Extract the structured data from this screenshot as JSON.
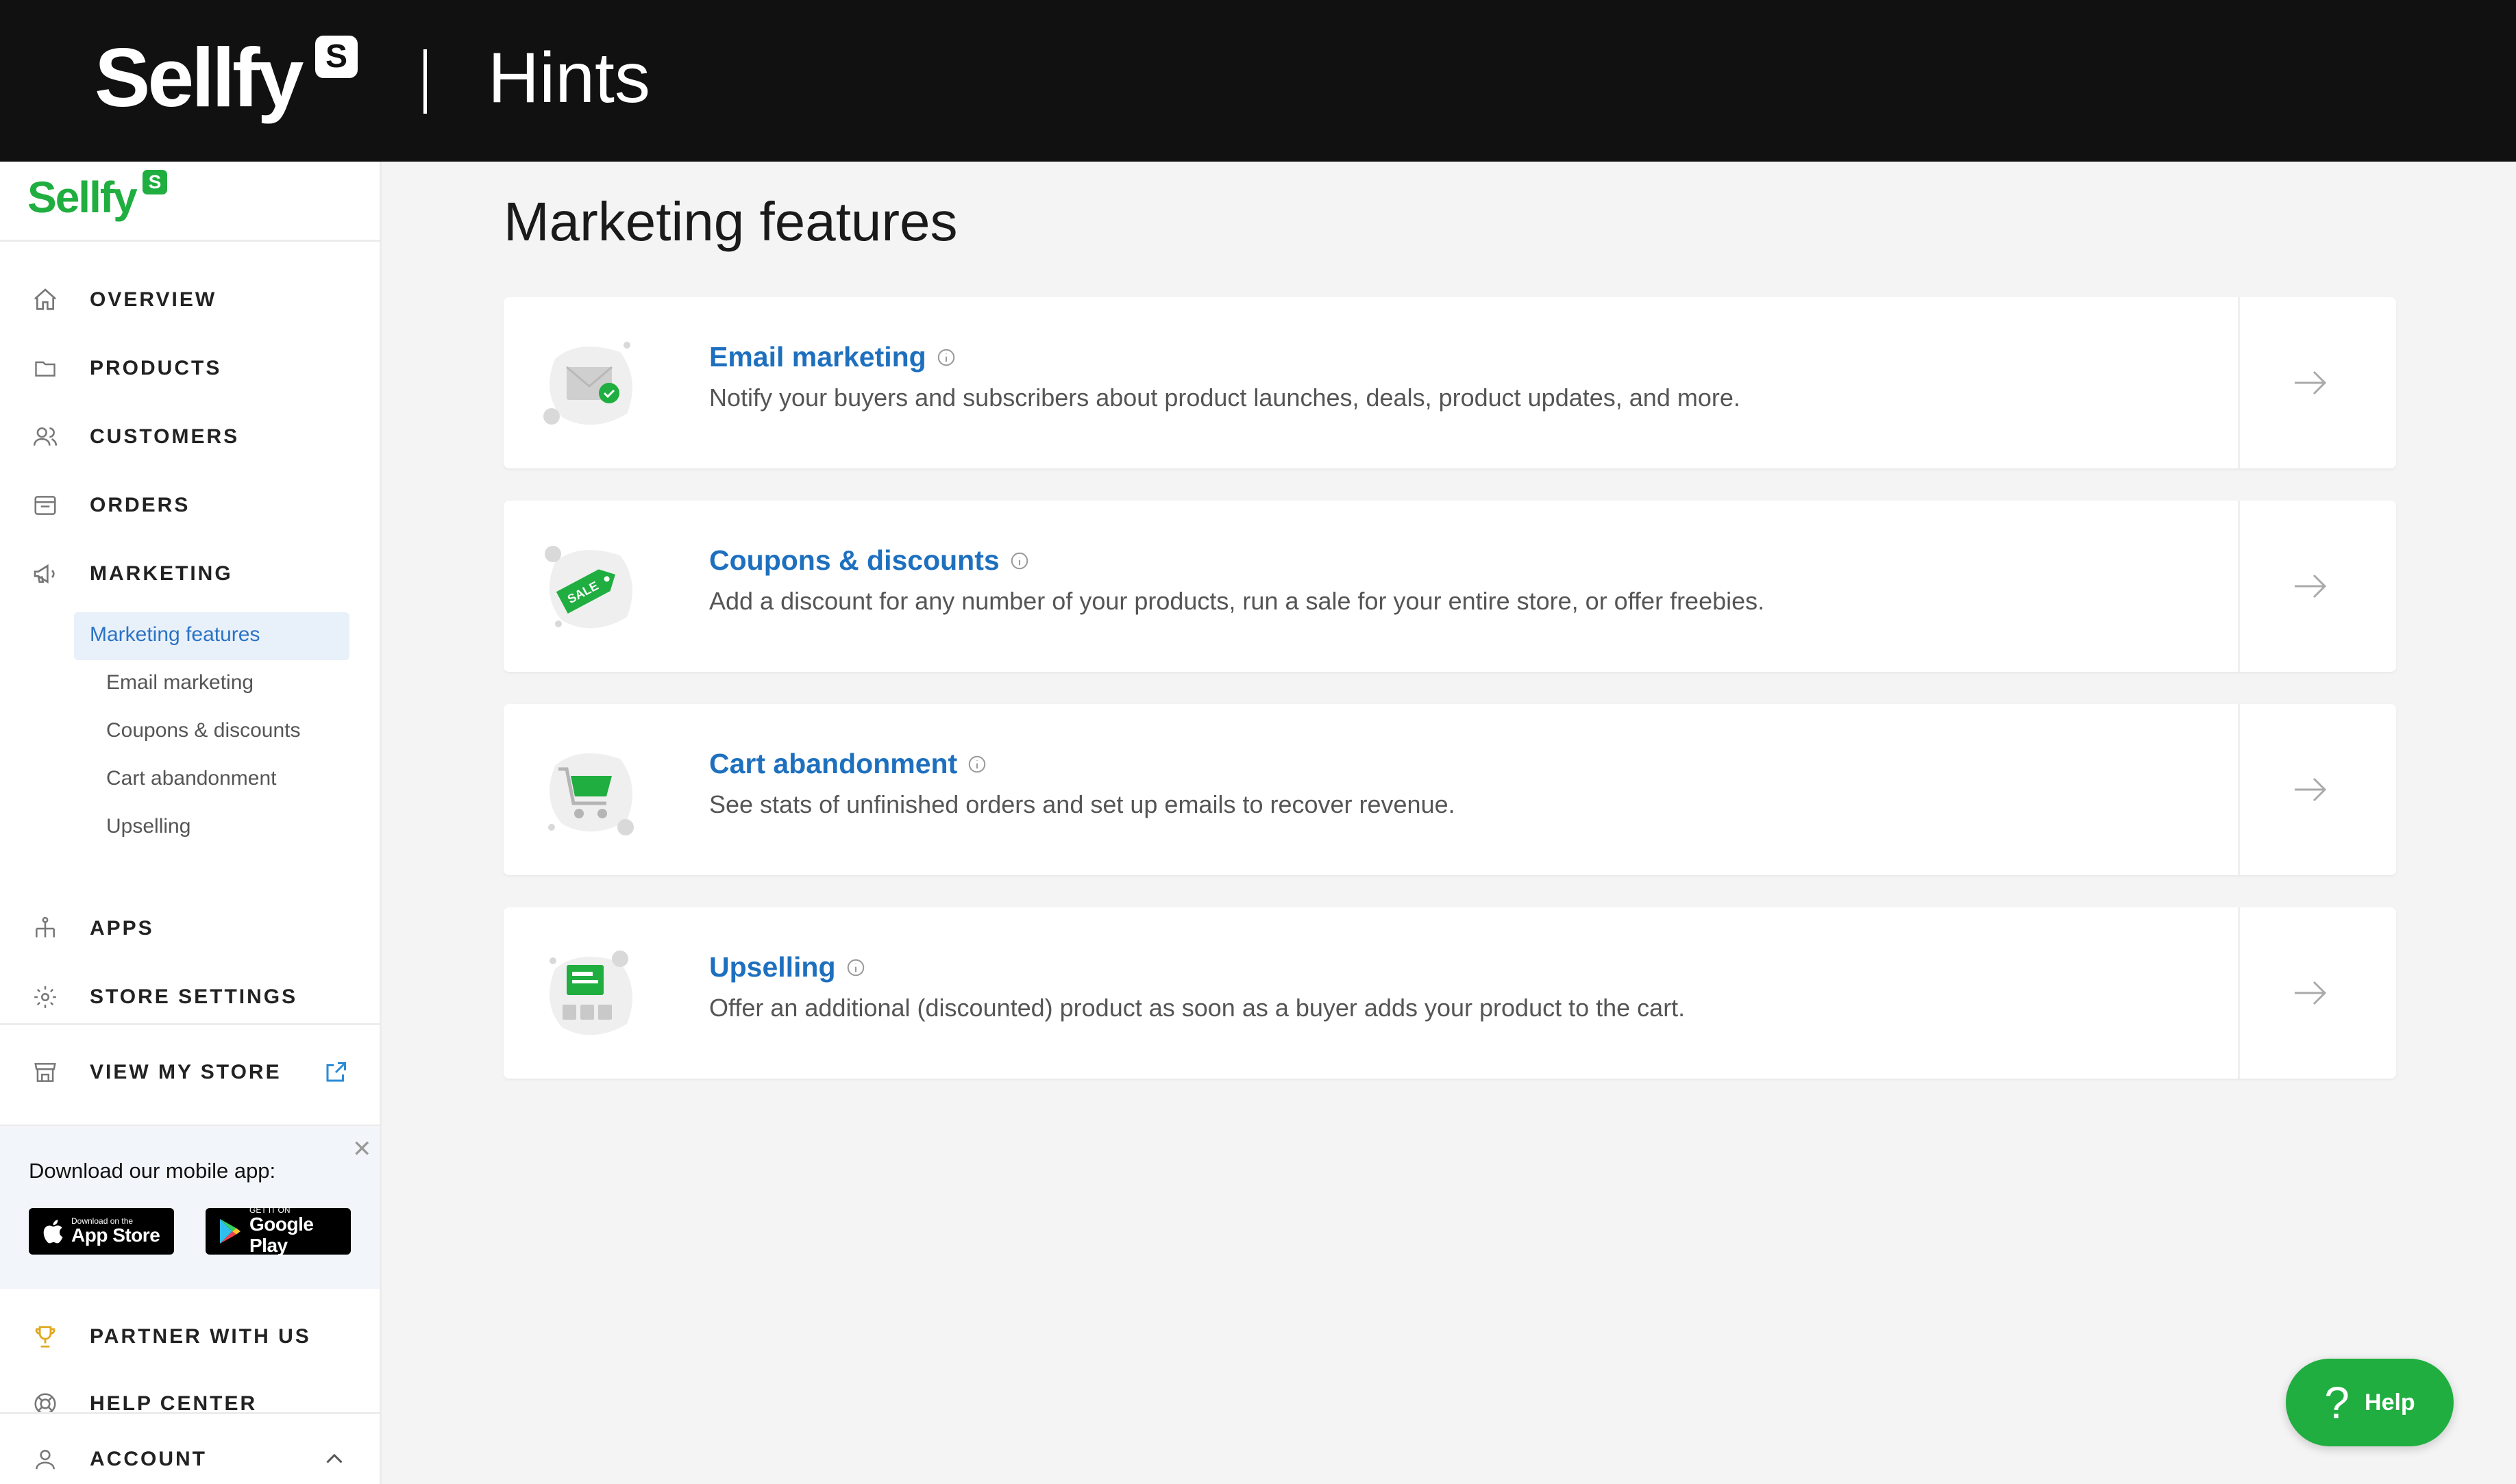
{
  "banner": {
    "brand": "Sellfy",
    "brand_badge": "S",
    "title": "Hints"
  },
  "sidebar": {
    "logo": "Sellfy",
    "logo_badge": "S",
    "nav": [
      {
        "label": "OVERVIEW",
        "icon": "home-icon"
      },
      {
        "label": "PRODUCTS",
        "icon": "folder-icon"
      },
      {
        "label": "CUSTOMERS",
        "icon": "users-icon"
      },
      {
        "label": "ORDERS",
        "icon": "inbox-icon"
      },
      {
        "label": "MARKETING",
        "icon": "megaphone-icon"
      }
    ],
    "marketing_sub": [
      {
        "label": "Marketing features",
        "active": true
      },
      {
        "label": "Email marketing"
      },
      {
        "label": "Coupons & discounts"
      },
      {
        "label": "Cart abandonment"
      },
      {
        "label": "Upselling"
      }
    ],
    "nav2": [
      {
        "label": "APPS",
        "icon": "apps-icon"
      },
      {
        "label": "STORE SETTINGS",
        "icon": "gear-icon"
      }
    ],
    "view_store": {
      "label": "VIEW MY STORE",
      "icon": "storefront-icon"
    },
    "mobile_app": {
      "title": "Download our mobile app:",
      "app_store_small": "Download on the",
      "app_store_big": "App Store",
      "google_small": "GET IT ON",
      "google_big": "Google Play"
    },
    "bottom": [
      {
        "label": "PARTNER WITH US",
        "icon": "trophy-icon"
      },
      {
        "label": "HELP CENTER",
        "icon": "lifebuoy-icon"
      },
      {
        "label": "ACCOUNT",
        "icon": "user-icon"
      }
    ]
  },
  "main": {
    "title": "Marketing features",
    "cards": [
      {
        "title": "Email marketing",
        "desc": "Notify your buyers and subscribers about product launches, deals, product updates, and more."
      },
      {
        "title": "Coupons & discounts",
        "desc": "Add a discount for any number of your products, run a sale for your entire store, or offer freebies.",
        "tag_text": "SALE"
      },
      {
        "title": "Cart abandonment",
        "desc": "See stats of unfinished orders and set up emails to recover revenue."
      },
      {
        "title": "Upselling",
        "desc": "Offer an additional (discounted) product as soon as a buyer adds your product to the cart."
      }
    ]
  },
  "help": {
    "label": "Help",
    "glyph": "?"
  },
  "colors": {
    "accent_green": "#1fae3f",
    "link_blue": "#1e70bf",
    "banner": "#111111"
  }
}
